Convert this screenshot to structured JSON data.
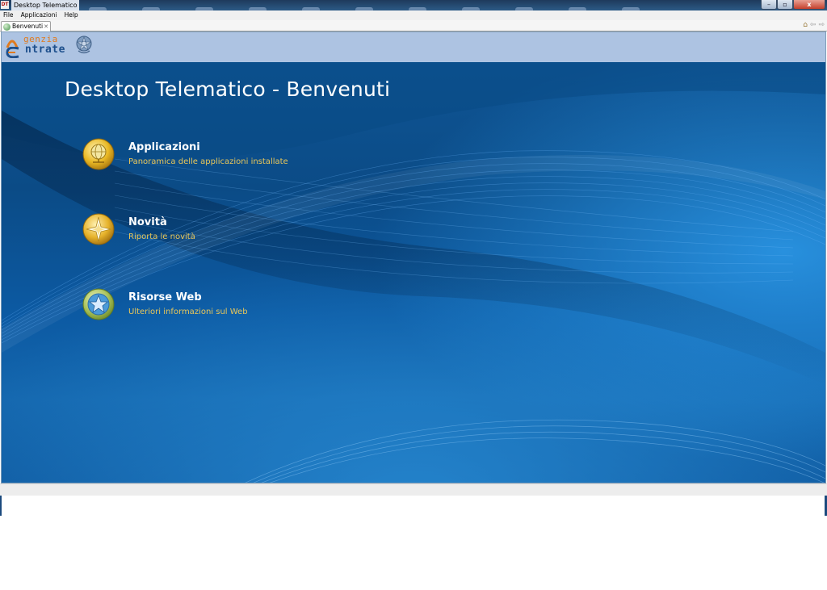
{
  "window": {
    "app_icon": "DT",
    "title": "Desktop Telematico",
    "minimize_symbol": "–",
    "maximize_symbol": "▫",
    "close_symbol": "x"
  },
  "menu": [
    "File",
    "Applicazioni",
    "Help"
  ],
  "tab": {
    "label": "Benvenuti",
    "close_symbol": "✕",
    "icon": "globe-icon"
  },
  "nav": {
    "home_symbol": "⌂",
    "back_symbol": "⇦",
    "forward_symbol": "⇨"
  },
  "logo": {
    "line1": "genzia",
    "line2": "ntrate"
  },
  "page": {
    "title": "Desktop Telematico - Benvenuti",
    "items": [
      {
        "title": "Applicazioni",
        "subtitle": "Panoramica delle applicazioni installate",
        "icon": "globe-icon"
      },
      {
        "title": "Novità",
        "subtitle": "Riporta le novità",
        "icon": "star-icon"
      },
      {
        "title": "Risorse Web",
        "subtitle": "Ulteriori informazioni sul Web",
        "icon": "web-star-icon"
      }
    ]
  },
  "colors": {
    "hero_blue": "#0b4b86",
    "header_blue": "#adc3e2",
    "subtitle_gold": "#e8c659",
    "logo_orange": "#e07b1f",
    "logo_blue": "#1d4f8c"
  }
}
